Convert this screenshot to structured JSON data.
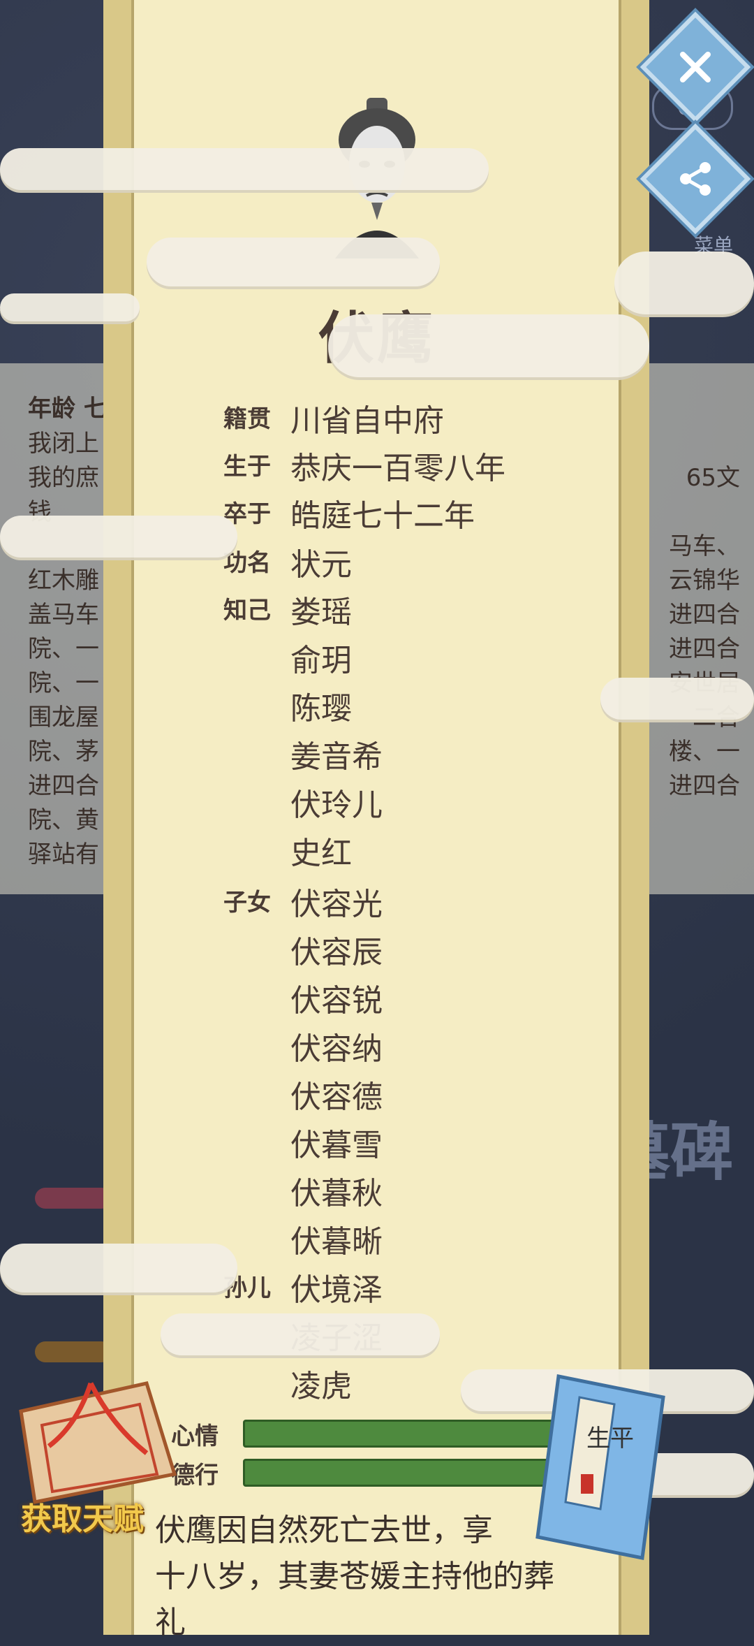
{
  "background": {
    "age_label": "年龄 七",
    "coin_count": "65",
    "menu_label": "菜单",
    "tomb_label": "墓碑",
    "left_lines": [
      "我闭上",
      "我的庶",
      "钱",
      "",
      "红木雕",
      "盖马车",
      "院、一",
      "院、一",
      "围龙屋",
      "院、茅",
      "进四合",
      "院、黄",
      "驿站有"
    ],
    "right_lines": [
      "65文",
      "",
      "马车、",
      "云锦华",
      "进四合",
      "进四合",
      "安世居",
      "二合",
      "楼、一",
      "进四合"
    ]
  },
  "person": {
    "name": "伏鹰",
    "origin_label": "籍贯",
    "origin": "川省自中府",
    "born_label": "生于",
    "born": "恭庆一百零八年",
    "died_label": "卒于",
    "died": "皓庭七十二年",
    "rank_label": "功名",
    "rank": "状元",
    "friends_label": "知己",
    "friends": [
      "娄瑶",
      "俞玥",
      "陈璎",
      "姜音希",
      "伏玲儿",
      "史红"
    ],
    "children_label": "子女",
    "children": [
      "伏容光",
      "伏容辰",
      "伏容锐",
      "伏容纳",
      "伏容德",
      "伏暮雪",
      "伏暮秋",
      "伏暮晰"
    ],
    "grandchildren_label": "孙儿",
    "grandchildren": [
      "伏境泽",
      "凌子涩",
      "凌虎"
    ]
  },
  "stats": {
    "mood_label": "心情",
    "mood": 1.0,
    "virtue_label": "德行",
    "virtue": 1.0
  },
  "bio": "伏鹰因自然死亡去世，享年七十八岁，其妻苍媛主持他的葬礼。",
  "bio_shown": "伏鹰因自然死亡去世，享\n十八岁，其妻苍媛主持他的葬\n礼",
  "buttons": {
    "talent_label": "获取天赋",
    "book_label": "生平"
  },
  "colors": {
    "scroll_paper": "#f5edc4",
    "scroll_border": "#d9c888",
    "bar_green": "#4e8a3e",
    "talent_gold": "#f2c94c"
  }
}
